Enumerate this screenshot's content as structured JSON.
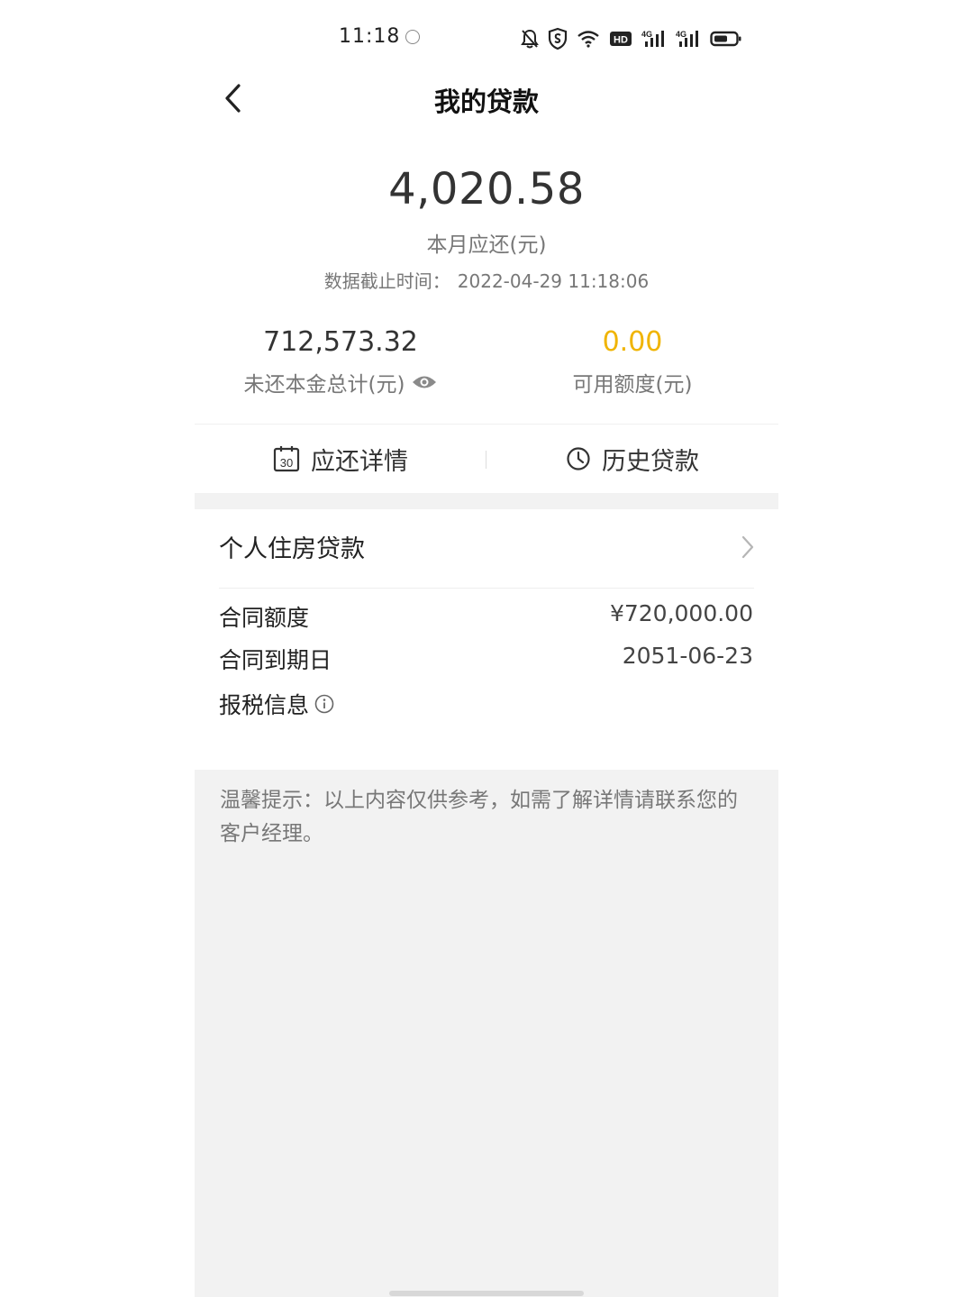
{
  "status_bar": {
    "time": "11:18",
    "icons": [
      "app-notification-icon",
      "mute-bell-icon",
      "shield-icon",
      "wifi-icon",
      "hd-icon",
      "signal-4g-icon",
      "signal-4g-icon",
      "battery-icon"
    ],
    "hd_label": "HD",
    "network_label_1": "4G",
    "network_label_2": "4G"
  },
  "nav": {
    "title": "我的贷款"
  },
  "summary": {
    "monthly_amount": "4,020.58",
    "monthly_label": "本月应还(元)",
    "cutoff_label": "数据截止时间：",
    "cutoff_value": "2022-04-29 11:18:06"
  },
  "stats": {
    "principal_value": "712,573.32",
    "principal_label": "未还本金总计(元)",
    "credit_value": "0.00",
    "credit_label": "可用额度(元)"
  },
  "actions": {
    "repayment_details": "应还详情",
    "history_loans": "历史贷款",
    "calendar_day": "30"
  },
  "loan": {
    "title": "个人住房贷款",
    "rows": [
      {
        "label": "合同额度",
        "value": "¥720,000.00"
      },
      {
        "label": "合同到期日",
        "value": "2051-06-23"
      },
      {
        "label": "报税信息",
        "value": ""
      }
    ]
  },
  "tips": {
    "text": "温馨提示：以上内容仅供参考，如需了解详情请联系您的客户经理。"
  },
  "colors": {
    "accent_gold": "#f0b400",
    "background_gray": "#f2f2f2"
  }
}
